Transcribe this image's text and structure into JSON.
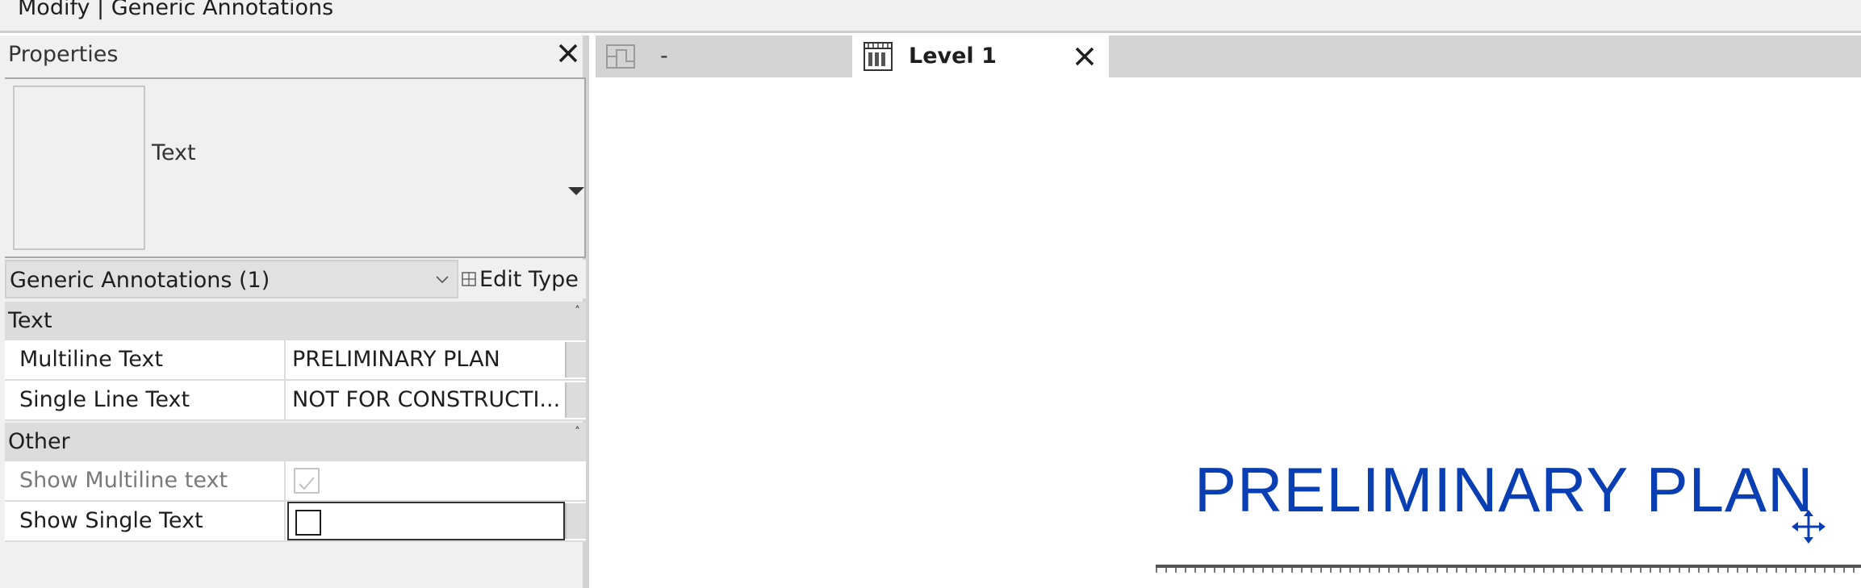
{
  "ribbon": {
    "context_title": "Modify | Generic Annotations"
  },
  "properties": {
    "header_label": "Properties",
    "type_selector": {
      "type_name": "Text"
    },
    "filter": {
      "selected": "Generic Annotations (1)",
      "edit_type_label": "Edit Type"
    },
    "groups": [
      {
        "label": "Text",
        "rows": [
          {
            "name": "Multiline Text",
            "value": "PRELIMINARY PLAN"
          },
          {
            "name": "Single Line Text",
            "value": "NOT FOR CONSTRUCTI..."
          }
        ]
      },
      {
        "label": "Other",
        "rows": [
          {
            "name": "Show Multiline text",
            "checked": true,
            "enabled": false
          },
          {
            "name": "Show Single Text",
            "checked": false,
            "enabled": true
          }
        ]
      }
    ]
  },
  "view_tabs": [
    {
      "label": "-",
      "active": false,
      "icon": "floor-plan-icon"
    },
    {
      "label": "Level 1",
      "active": true,
      "icon": "sheet-view-icon"
    }
  ],
  "canvas": {
    "annotation_text": "PRELIMINARY PLAN",
    "annotation_color": "#0a3fb4"
  },
  "colors": {
    "panel_bg": "#f0f0f0",
    "group_bg": "#dcdcdc",
    "accent_blue": "#0a3fb4"
  }
}
